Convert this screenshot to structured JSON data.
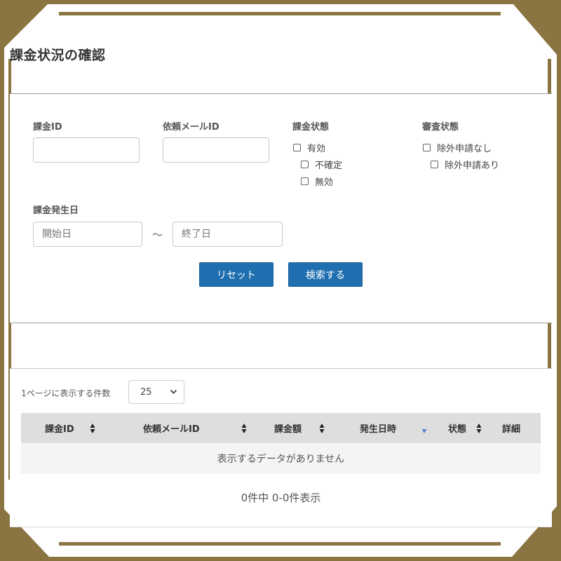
{
  "page": {
    "title": "課金状況の確認"
  },
  "filters": {
    "billing_id_label": "課金ID",
    "request_mail_id_label": "依頼メールID",
    "billing_status_label": "課金状態",
    "billing_status_options": [
      "有効",
      "不確定",
      "無効"
    ],
    "review_status_label": "審査状態",
    "review_status_options": [
      "除外申請なし",
      "除外申請あり"
    ],
    "date_label": "課金発生日",
    "start_placeholder": "開始日",
    "end_placeholder": "終了日",
    "range_sep": "〜",
    "reset_label": "リセット",
    "search_label": "検索する"
  },
  "results": {
    "per_page_label": "1ページに表示する件数",
    "per_page_value": "25",
    "columns": [
      "課金ID",
      "依頼メールID",
      "課金額",
      "発生日時",
      "状態",
      "詳細"
    ],
    "empty_message": "表示するデータがありません",
    "info": "0件中 0-0件表示"
  },
  "colors": {
    "frame": "#8a7442",
    "primary_button": "#1f6fb0",
    "header_bg": "#dedede",
    "active_sort": "#5b7fd6"
  }
}
